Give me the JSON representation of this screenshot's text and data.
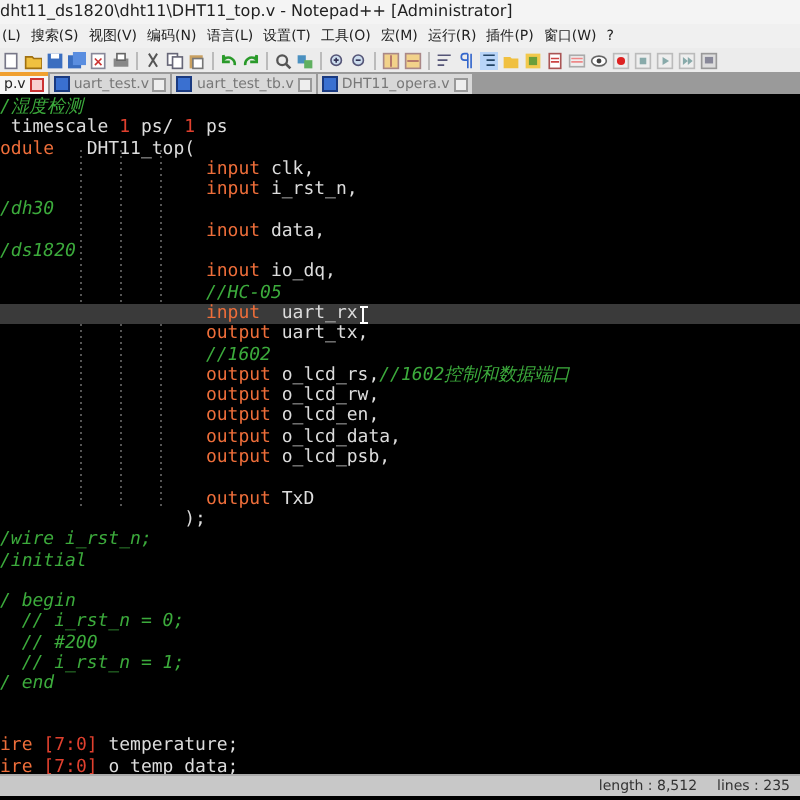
{
  "window": {
    "title": "dht11_ds1820\\dht11\\DHT11_top.v - Notepad++ [Administrator]"
  },
  "menu": [
    "(L)",
    "搜索(S)",
    "视图(V)",
    "编码(N)",
    "语言(L)",
    "设置(T)",
    "工具(O)",
    "宏(M)",
    "运行(R)",
    "插件(P)",
    "窗口(W)",
    "?"
  ],
  "tabs": [
    {
      "label": "p.v",
      "selected": true
    },
    {
      "label": "uart_test.v",
      "selected": false
    },
    {
      "label": "uart_test_tb.v",
      "selected": false
    },
    {
      "label": "DHT11_opera.v",
      "selected": false
    }
  ],
  "code_lines": [
    {
      "kind": "code",
      "current": false,
      "segments": [
        {
          "kind": "comment",
          "text": "/湿度检测"
        }
      ]
    },
    {
      "kind": "code",
      "current": false,
      "segments": [
        {
          "kind": "text",
          "text": " timescale "
        },
        {
          "kind": "number",
          "text": "1"
        },
        {
          "kind": "text",
          "text": " ps/ "
        },
        {
          "kind": "number",
          "text": "1"
        },
        {
          "kind": "text",
          "text": " ps"
        }
      ]
    },
    {
      "kind": "code",
      "current": false,
      "segments": [
        {
          "kind": "keyword",
          "text": "odule"
        },
        {
          "kind": "text",
          "text": "   DHT11_top("
        }
      ]
    },
    {
      "kind": "port",
      "current": false,
      "segments": [
        {
          "kind": "keyword",
          "text": "input"
        },
        {
          "kind": "text",
          "text": " clk,"
        }
      ]
    },
    {
      "kind": "port",
      "current": false,
      "segments": [
        {
          "kind": "keyword",
          "text": "input"
        },
        {
          "kind": "text",
          "text": " i_rst_n,"
        }
      ]
    },
    {
      "kind": "code",
      "current": false,
      "segments": [
        {
          "kind": "comment",
          "text": "/dh30"
        }
      ]
    },
    {
      "kind": "port",
      "current": false,
      "segments": [
        {
          "kind": "keyword",
          "text": "inout"
        },
        {
          "kind": "text",
          "text": " data,"
        }
      ]
    },
    {
      "kind": "code",
      "current": false,
      "segments": [
        {
          "kind": "comment",
          "text": "/ds1820"
        }
      ]
    },
    {
      "kind": "port",
      "current": false,
      "segments": [
        {
          "kind": "keyword",
          "text": "inout"
        },
        {
          "kind": "text",
          "text": " io_dq,"
        }
      ]
    },
    {
      "kind": "port",
      "current": false,
      "segments": [
        {
          "kind": "comment",
          "text": "//HC-05"
        }
      ]
    },
    {
      "kind": "port",
      "current": true,
      "segments": [
        {
          "kind": "keyword",
          "text": "input"
        },
        {
          "kind": "text",
          "text": "  uart_rx"
        }
      ]
    },
    {
      "kind": "port",
      "current": false,
      "segments": [
        {
          "kind": "keyword",
          "text": "output"
        },
        {
          "kind": "text",
          "text": " uart_tx,"
        }
      ]
    },
    {
      "kind": "port",
      "current": false,
      "segments": [
        {
          "kind": "comment",
          "text": "//1602"
        }
      ]
    },
    {
      "kind": "port",
      "current": false,
      "segments": [
        {
          "kind": "keyword",
          "text": "output"
        },
        {
          "kind": "text",
          "text": " o_lcd_rs,"
        },
        {
          "kind": "comment",
          "text": "//1602控制和数据端口"
        }
      ]
    },
    {
      "kind": "port",
      "current": false,
      "segments": [
        {
          "kind": "keyword",
          "text": "output"
        },
        {
          "kind": "text",
          "text": " o_lcd_rw,"
        }
      ]
    },
    {
      "kind": "port",
      "current": false,
      "segments": [
        {
          "kind": "keyword",
          "text": "output"
        },
        {
          "kind": "text",
          "text": " o_lcd_en,"
        }
      ]
    },
    {
      "kind": "port",
      "current": false,
      "segments": [
        {
          "kind": "keyword",
          "text": "output"
        },
        {
          "kind": "text",
          "text": " o_lcd_data,"
        }
      ]
    },
    {
      "kind": "port",
      "current": false,
      "segments": [
        {
          "kind": "keyword",
          "text": "output"
        },
        {
          "kind": "text",
          "text": " o_lcd_psb,"
        }
      ]
    },
    {
      "kind": "blank"
    },
    {
      "kind": "port",
      "current": false,
      "segments": [
        {
          "kind": "keyword",
          "text": "output"
        },
        {
          "kind": "text",
          "text": " TxD"
        }
      ]
    },
    {
      "kind": "close",
      "current": false,
      "segments": [
        {
          "kind": "text",
          "text": ");"
        }
      ]
    },
    {
      "kind": "code",
      "current": false,
      "segments": [
        {
          "kind": "comment",
          "text": "/wire i_rst_n;"
        }
      ]
    },
    {
      "kind": "code",
      "current": false,
      "segments": [
        {
          "kind": "comment",
          "text": "/initial"
        }
      ]
    },
    {
      "kind": "blank"
    },
    {
      "kind": "code",
      "current": false,
      "segments": [
        {
          "kind": "comment",
          "text": "/ begin"
        }
      ]
    },
    {
      "kind": "code",
      "current": false,
      "segments": [
        {
          "kind": "comment",
          "text": "  // i_rst_n = 0;"
        }
      ]
    },
    {
      "kind": "code",
      "current": false,
      "segments": [
        {
          "kind": "comment",
          "text": "  // #200"
        }
      ]
    },
    {
      "kind": "code",
      "current": false,
      "segments": [
        {
          "kind": "comment",
          "text": "  // i_rst_n = 1;"
        }
      ]
    },
    {
      "kind": "code",
      "current": false,
      "segments": [
        {
          "kind": "comment",
          "text": "/ end"
        }
      ]
    },
    {
      "kind": "blank"
    },
    {
      "kind": "blank"
    },
    {
      "kind": "code",
      "current": false,
      "segments": [
        {
          "kind": "keyword",
          "text": "ire"
        },
        {
          "kind": "number",
          "text": " [7:0]"
        },
        {
          "kind": "text",
          "text": " temperature;"
        }
      ]
    },
    {
      "kind": "code",
      "current": false,
      "segments": [
        {
          "kind": "keyword",
          "text": "ire"
        },
        {
          "kind": "number",
          "text": " [7:0]"
        },
        {
          "kind": "text",
          "text": " o_temp_data;"
        }
      ]
    }
  ],
  "status_bar": {
    "length": "length : 8,512",
    "lines": "lines : 235"
  }
}
